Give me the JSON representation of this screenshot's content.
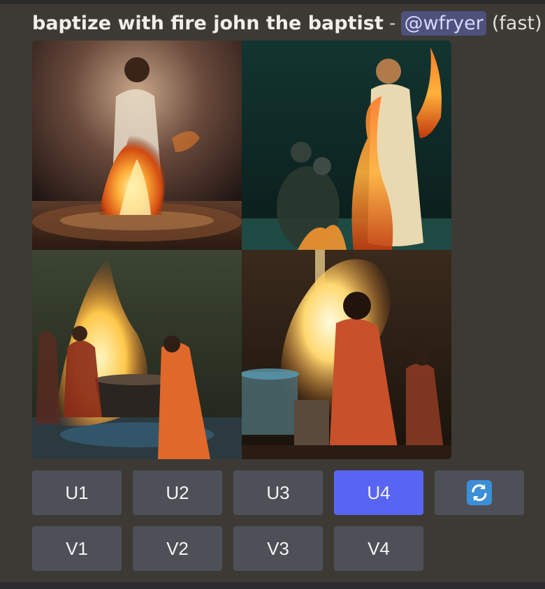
{
  "message": {
    "prompt": "baptize with fire john the baptist",
    "separator": "-",
    "mention": "@wfryer",
    "speed": "(fast)"
  },
  "grid": {
    "images": [
      {
        "index": 1,
        "description": "figure in white robe standing in water engulfed in flame"
      },
      {
        "index": 2,
        "description": "robed figure beside rising fire in dark green pool"
      },
      {
        "index": 3,
        "description": "people gathered around a font with large flames"
      },
      {
        "index": 4,
        "description": "figure in red cloak before a wall of fire"
      }
    ]
  },
  "buttons": {
    "upscale": [
      {
        "label": "U1",
        "active": false
      },
      {
        "label": "U2",
        "active": false
      },
      {
        "label": "U3",
        "active": false
      },
      {
        "label": "U4",
        "active": true
      }
    ],
    "variation": [
      {
        "label": "V1"
      },
      {
        "label": "V2"
      },
      {
        "label": "V3"
      },
      {
        "label": "V4"
      }
    ],
    "reroll_icon": "reroll-icon"
  },
  "colors": {
    "accent": "#5865f2",
    "button": "#4d5157",
    "background": "#3d3a36",
    "mention_bg": "#4e517b"
  }
}
